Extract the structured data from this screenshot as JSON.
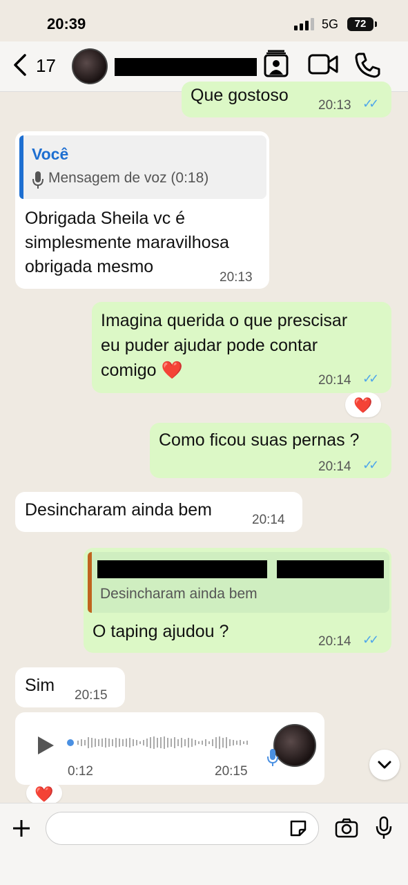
{
  "status_bar": {
    "time": "20:39",
    "network": "5G",
    "battery": "72"
  },
  "header": {
    "back_count": "17"
  },
  "messages": [
    {
      "type": "out",
      "text": "Que gostoso",
      "time": "20:13"
    },
    {
      "type": "in",
      "quote_author": "Você",
      "quote_text": "Mensagem de voz (0:18)",
      "text_lines": [
        "Obrigada Sheila vc é",
        "simplesmente maravilhosa",
        "obrigada mesmo"
      ],
      "time": "20:13"
    },
    {
      "type": "out",
      "text_lines": [
        "Imagina querida o que prescisar",
        "eu puder ajudar pode contar",
        "comigo ❤️"
      ],
      "time": "20:14",
      "reaction": "❤️"
    },
    {
      "type": "out",
      "text": "Como ficou suas pernas ?",
      "time": "20:14"
    },
    {
      "type": "in",
      "text": "Desincharam ainda bem",
      "time": "20:14"
    },
    {
      "type": "out",
      "quote_text": "Desincharam ainda bem",
      "text": "O taping ajudou ?",
      "time": "20:14"
    },
    {
      "type": "in",
      "text": "Sim",
      "time": "20:15"
    },
    {
      "type": "in-voice",
      "duration": "0:12",
      "time": "20:15",
      "reaction": "❤️"
    }
  ],
  "icons": {
    "back": "chevron-left-icon",
    "contact_card": "contact-card-icon",
    "video": "video-camera-icon",
    "phone": "phone-icon",
    "mic_quote": "microphone-icon",
    "play": "play-icon",
    "scroll_down": "chevron-down-icon",
    "add": "plus-icon",
    "sticker": "sticker-icon",
    "camera": "camera-icon",
    "mic": "microphone-icon"
  },
  "colors": {
    "outgoing": "#dcf8c6",
    "incoming": "#ffffff",
    "quote_bar_out": "#c0641e",
    "quote_bar_in": "#1e6fd1",
    "ticks": "#4fa6ea",
    "author": "#1e6fd1"
  }
}
